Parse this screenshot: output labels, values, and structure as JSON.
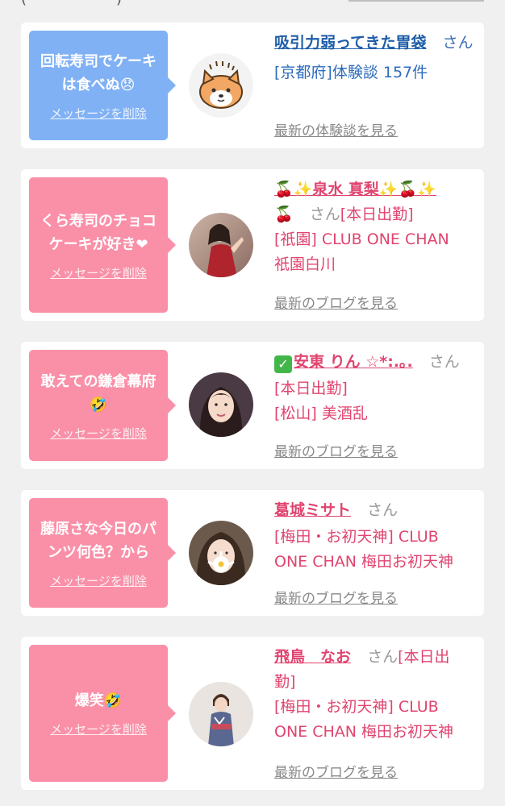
{
  "top": {
    "paren_left": "(",
    "paren_right": ")"
  },
  "colors": {
    "blue_bubble": "#80b1f5",
    "pink_bubble": "#fa90a8",
    "pink_text": "#e0446f",
    "blue_text": "#1f5da8"
  },
  "cards": [
    {
      "message": "回転寿司でケーキは食べぬ😞",
      "delete_label": "メッセージを削除",
      "avatar": "shiba-dog-avatar",
      "name": "吸引力弱ってきた胃袋",
      "san": "さん",
      "details": [
        "[京都府]体験談 157件"
      ],
      "latest": "最新の体験談を見る"
    },
    {
      "message": "くら寿司のチョコケーキが好き❤",
      "delete_label": "メッセージを削除",
      "avatar": "woman-red-dress-avatar",
      "name": "🍒✨泉水 真梨✨🍒✨",
      "name_cont": "🍒",
      "san": "さん",
      "tag": "[本日出勤]",
      "details": [
        "[祇園] CLUB ONE CHAN",
        "祇園白川"
      ],
      "latest": "最新のブログを見る"
    },
    {
      "message": "敢えての鎌倉幕府🤣",
      "delete_label": "メッセージを削除",
      "avatar": "woman-selfie-avatar",
      "name_prefix": "✅",
      "name": "安東 りん ☆*:.｡.",
      "san": "さん",
      "details": [
        "[本日出勤]",
        "[松山] 美酒乱"
      ],
      "latest": "最新のブログを見る"
    },
    {
      "message": "藤原さな今日のパンツ何色？から",
      "delete_label": "メッセージを削除",
      "avatar": "woman-flower-avatar",
      "name": "葛城ミサト",
      "san": "さん",
      "details": [
        "[梅田・お初天神] CLUB",
        "ONE CHAN 梅田お初天神"
      ],
      "latest": "最新のブログを見る"
    },
    {
      "message": "爆笑🤣",
      "delete_label": "メッセージを削除",
      "avatar": "woman-kimono-avatar",
      "name": "飛鳥　なお",
      "san": "さん",
      "tag": "[本日出",
      "tag_cont": "勤]",
      "details": [
        "[梅田・お初天神] CLUB",
        "ONE CHAN 梅田お初天神"
      ],
      "latest": "最新のブログを見る"
    }
  ]
}
